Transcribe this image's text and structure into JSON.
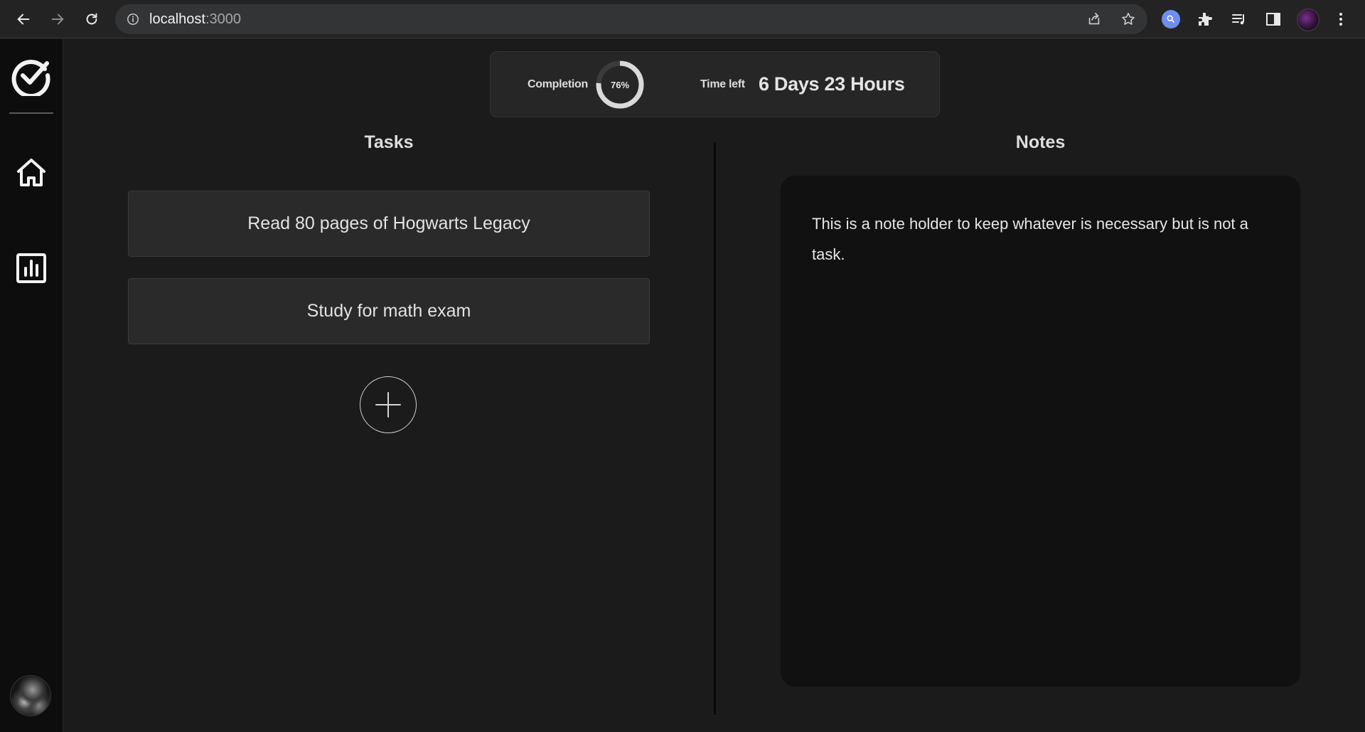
{
  "browser": {
    "url_host": "localhost",
    "url_port": ":3000"
  },
  "sidebar": {
    "items": [
      {
        "name": "home",
        "icon": "home-icon"
      },
      {
        "name": "statistics",
        "icon": "bar-chart-icon"
      }
    ]
  },
  "stats": {
    "completion_label": "Completion",
    "completion_percent": 76,
    "completion_text": "76%",
    "time_left_label": "Time left",
    "time_left_value": "6 Days 23 Hours"
  },
  "tasks": {
    "title": "Tasks",
    "items": [
      "Read 80 pages of Hogwarts Legacy",
      "Study for math exam"
    ]
  },
  "notes": {
    "title": "Notes",
    "content": "This is a note holder to keep whatever is necessary but is not a task."
  },
  "colors": {
    "background": "#1b1b1b",
    "sidebar": "#0d0d0d",
    "card": "#2a2a2a",
    "notes_panel": "#111111",
    "ring_track": "#3c3c3c",
    "ring_fill": "#d9d9d9"
  }
}
